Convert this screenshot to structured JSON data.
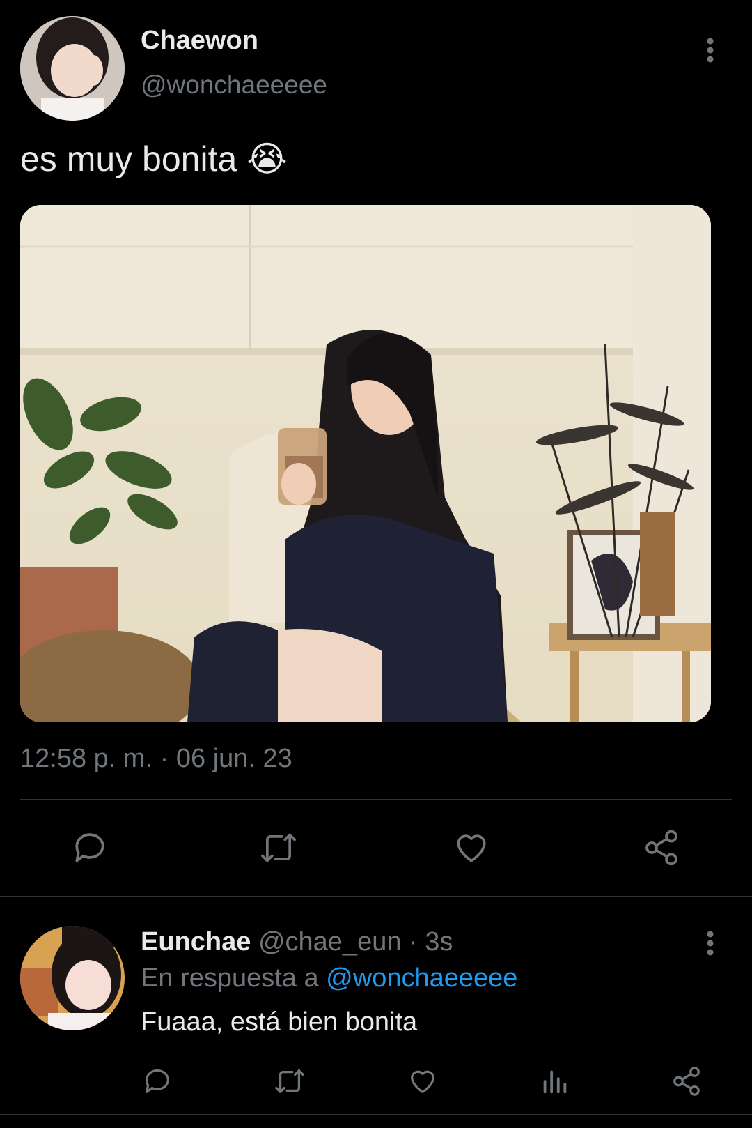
{
  "tweet": {
    "display_name": "Chaewon",
    "handle": "@wonchaeeeee",
    "text": "es muy bonita",
    "emoji": "😭",
    "timestamp": "12:58 p. m. · 06 jun. 23",
    "photo_icon": "photo-image"
  },
  "reply": {
    "display_name": "Eunchae",
    "handle_time": "@chae_eun · 3s",
    "replying_prefix": "En respuesta a",
    "replying_to": "@wonchaeeeee",
    "text": "Fuaaa, está bien bonita"
  },
  "icons": {
    "more": "more-vertical-icon",
    "reply": "reply-icon",
    "retweet": "retweet-icon",
    "like": "like-icon",
    "share": "share-icon",
    "stats": "stats-icon"
  },
  "colors": {
    "background": "#000000",
    "text": "#e7e9ea",
    "muted": "#71767b",
    "link": "#1d9bf0",
    "divider": "#2f3336"
  }
}
